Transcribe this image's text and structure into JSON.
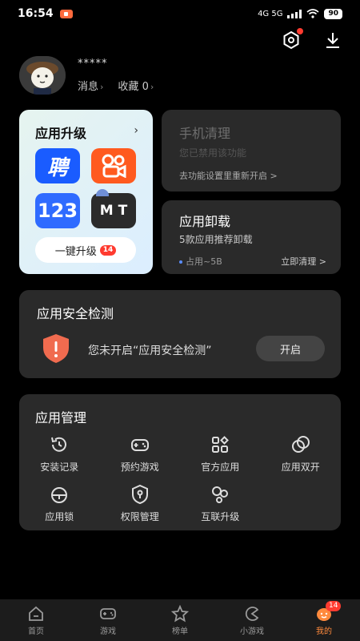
{
  "status_bar": {
    "time": "16:54",
    "network": "4G 5G",
    "battery": "90"
  },
  "profile": {
    "username": "*****",
    "messages_label": "消息",
    "favorites_label": "收藏",
    "favorites_count": "0"
  },
  "upgrade": {
    "title": "应用升级",
    "apps": [
      {
        "name": "聘",
        "bg": "#1a5cff",
        "fg": "#fff"
      },
      {
        "name": "kuaishou",
        "bg": "#ff5a1f",
        "fg": "#fff"
      },
      {
        "name": "123",
        "bg": "#2f6bff",
        "fg": "#fff"
      },
      {
        "name": "M T",
        "bg": "#2b2b2b",
        "fg": "#fff"
      }
    ],
    "button_label": "一键升级",
    "badge": "14"
  },
  "cleanup": {
    "title": "手机清理",
    "subtitle": "您已禁用该功能",
    "link": "去功能设置里重新开启 >"
  },
  "uninstall": {
    "title": "应用卸载",
    "subtitle": "5款应用推荐卸载",
    "usage": "占用~5B",
    "action": "立即清理 >"
  },
  "security": {
    "title": "应用安全检测",
    "message": "您未开启“应用安全检测”",
    "button": "开启"
  },
  "management": {
    "title": "应用管理",
    "items": [
      {
        "label": "安装记录",
        "icon": "history-icon"
      },
      {
        "label": "预约游戏",
        "icon": "gamepad-icon"
      },
      {
        "label": "官方应用",
        "icon": "apps-grid-icon"
      },
      {
        "label": "应用双开",
        "icon": "dual-circle-icon"
      },
      {
        "label": "应用锁",
        "icon": "lock-icon"
      },
      {
        "label": "权限管理",
        "icon": "shield-key-icon"
      },
      {
        "label": "互联升级",
        "icon": "link-icon"
      }
    ]
  },
  "nav": {
    "items": [
      {
        "label": "首页"
      },
      {
        "label": "游戏"
      },
      {
        "label": "榜单"
      },
      {
        "label": "小游戏"
      },
      {
        "label": "我的"
      }
    ],
    "mine_badge": "14",
    "accent": "#ff8a3d"
  }
}
